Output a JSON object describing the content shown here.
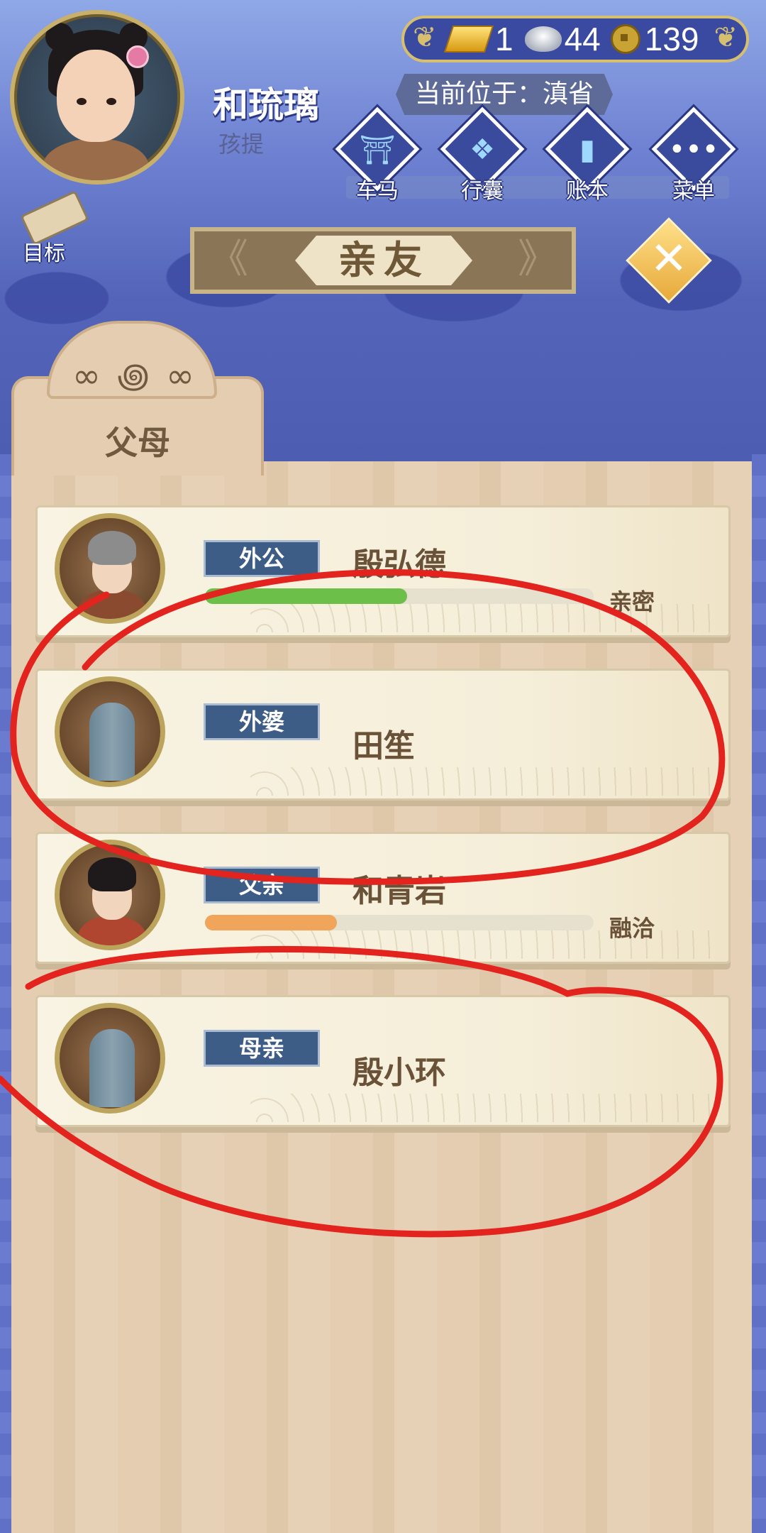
{
  "player": {
    "name": "和琉璃",
    "title": "孩提",
    "location": "当前位于：滇省"
  },
  "currency": {
    "gold": "1",
    "silver": "44",
    "copper": "139"
  },
  "nav": {
    "items": [
      {
        "label": "车马",
        "icon": "carriage-icon"
      },
      {
        "label": "行囊",
        "icon": "bundle-icon"
      },
      {
        "label": "账本",
        "icon": "ledger-icon"
      },
      {
        "label": "菜单",
        "icon": "menu-icon"
      }
    ],
    "goal_label": "目标"
  },
  "screen": {
    "title": "亲友",
    "tab_label": "父母"
  },
  "relatives": [
    {
      "role": "外公",
      "name": "殷弘德",
      "status": "亲密",
      "affinity": 0.52,
      "bar_color": "#6cc04a",
      "portrait": "elder-man"
    },
    {
      "role": "外婆",
      "name": "田笙",
      "status": "",
      "portrait": "tombstone"
    },
    {
      "role": "父亲",
      "name": "和青岩",
      "status": "融洽",
      "affinity": 0.34,
      "bar_color": "#f0a55a",
      "portrait": "young-man"
    },
    {
      "role": "母亲",
      "name": "殷小环",
      "status": "",
      "portrait": "tombstone"
    }
  ],
  "colors": {
    "annotation_red": "#e3231d"
  }
}
